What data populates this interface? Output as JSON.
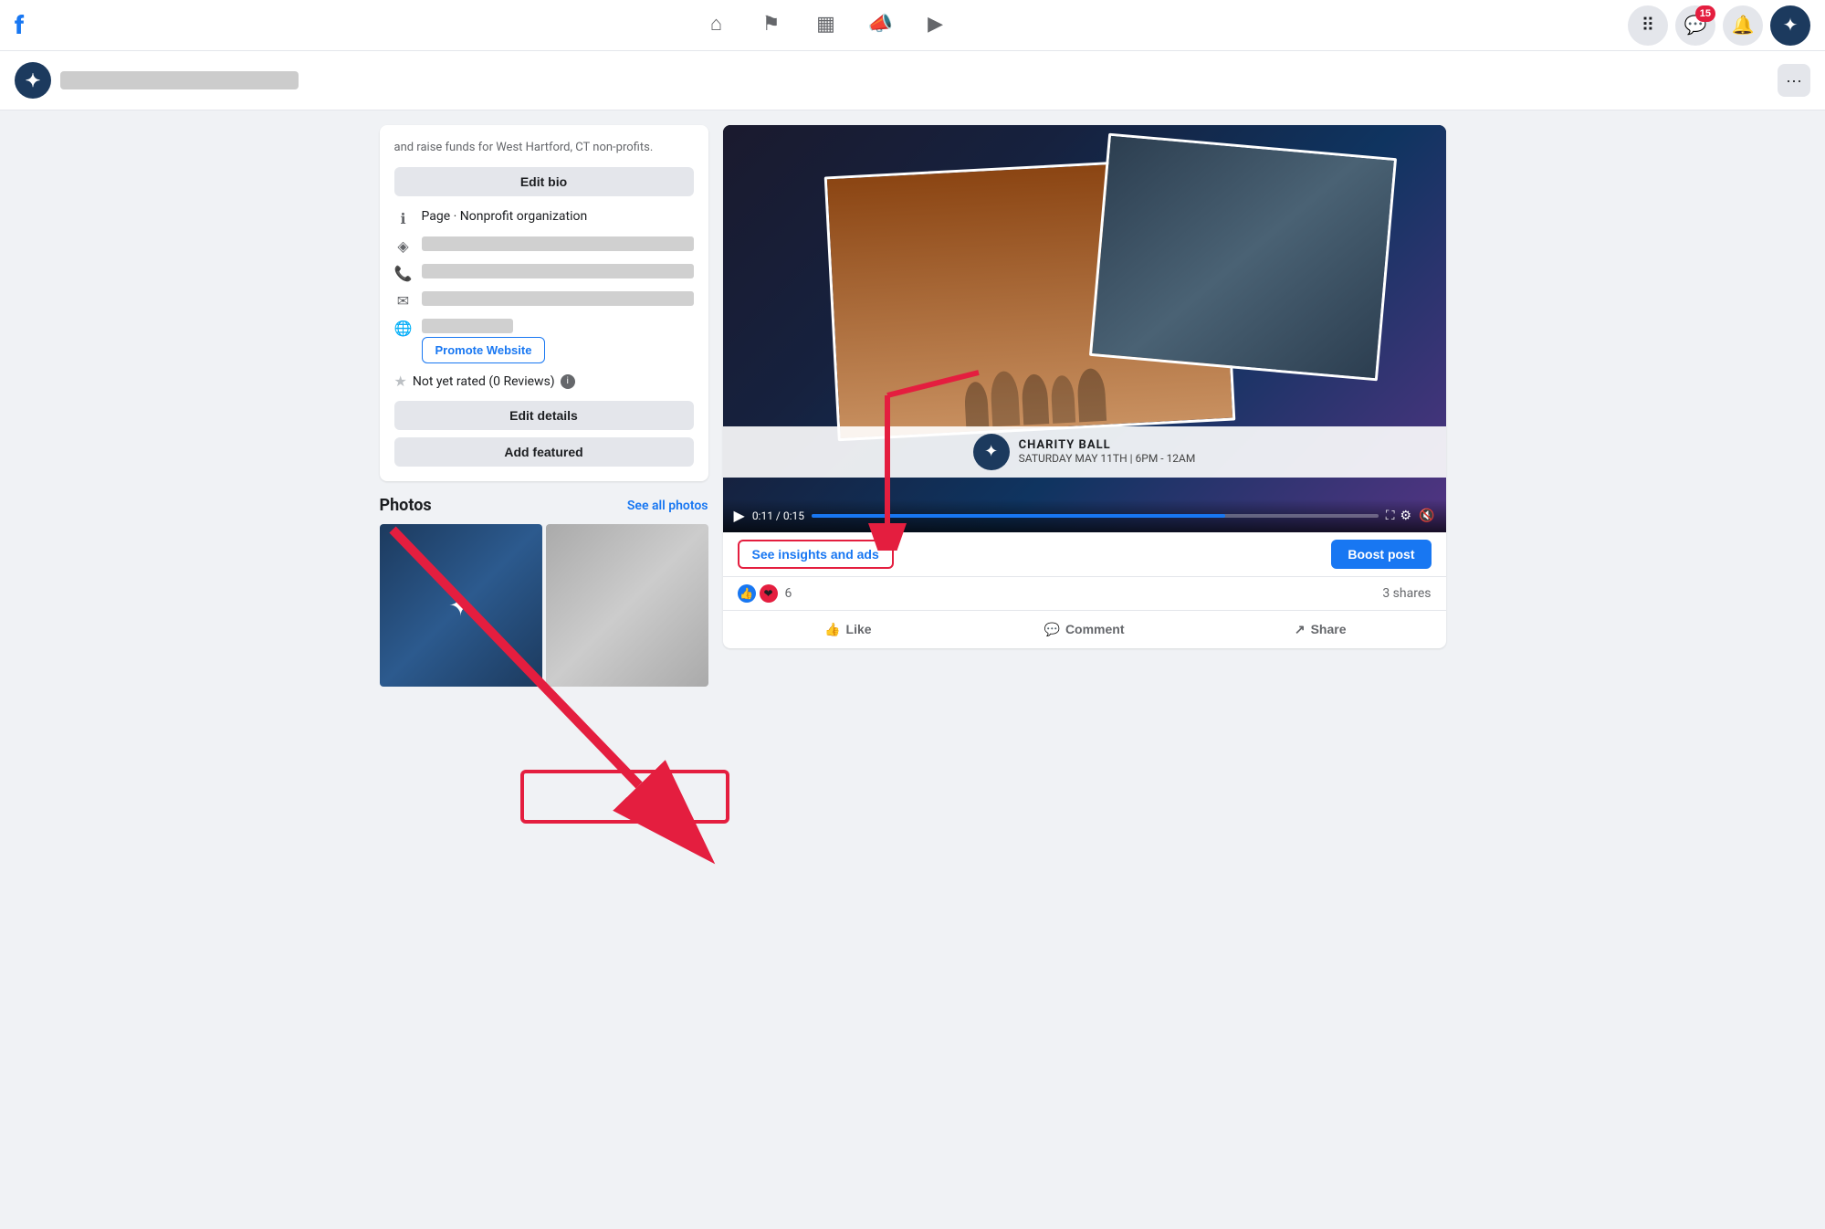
{
  "topNav": {
    "icons": [
      {
        "name": "home-icon",
        "symbol": "⌂",
        "label": "Home"
      },
      {
        "name": "flag-icon",
        "symbol": "⚑",
        "label": "Pages"
      },
      {
        "name": "chart-icon",
        "symbol": "▦",
        "label": "Insights"
      },
      {
        "name": "megaphone-icon",
        "symbol": "📣",
        "label": "Ads"
      },
      {
        "name": "video-icon",
        "symbol": "▶",
        "label": "Video"
      }
    ],
    "rightIcons": [
      {
        "name": "grid-icon",
        "symbol": "⠿",
        "label": "Menu"
      },
      {
        "name": "messenger-icon",
        "symbol": "💬",
        "label": "Messenger",
        "badge": "15"
      },
      {
        "name": "bell-icon",
        "symbol": "🔔",
        "label": "Notifications"
      },
      {
        "name": "account-icon",
        "symbol": "✦",
        "label": "Account"
      }
    ]
  },
  "pageHeader": {
    "logoSymbol": "✦",
    "name": "███████████████████████",
    "moreLabel": "···"
  },
  "sidebar": {
    "bioText": "and raise funds for West Hartford, CT non-profits.",
    "editBioLabel": "Edit bio",
    "pageTypeLabel": "Page · Nonprofit organization",
    "addressBlurred": "█████████████████████████████",
    "phoneBlurred": "████████████████",
    "emailBlurred": "████████████████████████",
    "websiteBlurred": "████████████████████████",
    "promoteWebsiteLabel": "Promote Website",
    "ratingText": "Not yet rated (0 Reviews)",
    "editDetailsLabel": "Edit details",
    "addFeaturedLabel": "Add featured"
  },
  "photos": {
    "title": "Photos",
    "seeAllLabel": "See all photos"
  },
  "post": {
    "videoTime": "0:11 / 0:15",
    "progressPercent": 73,
    "charityName": "CHARITY BALL",
    "charityDate": "SATURDAY MAY 11TH | 6PM - 12AM",
    "seeInsightsLabel": "See insights and ads",
    "boostPostLabel": "Boost post",
    "reactionCount": "6",
    "sharesText": "3 shares",
    "likeLabel": "Like",
    "commentLabel": "Comment",
    "shareLabel": "Share"
  }
}
